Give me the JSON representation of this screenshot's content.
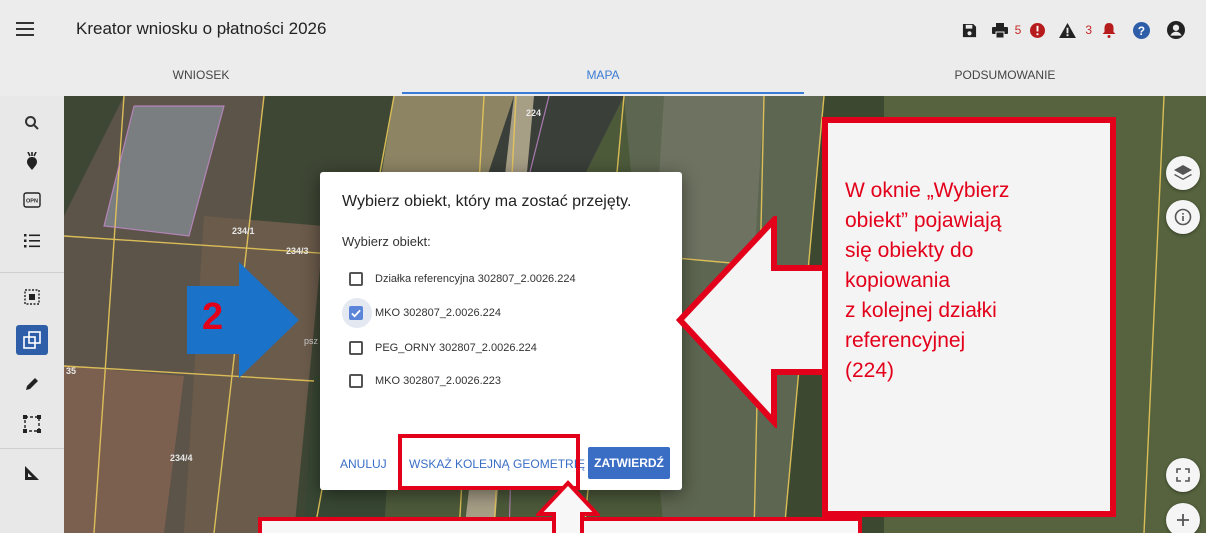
{
  "app": {
    "title": "Kreator wniosku o płatności 2026",
    "warning_count": "5",
    "alert_count": "3",
    "icons": [
      "menu-icon",
      "save-icon",
      "print-icon",
      "error-icon",
      "warning-icon",
      "bell-icon",
      "help-icon",
      "account-icon"
    ]
  },
  "tabs": [
    {
      "label": "WNIOSEK",
      "active": false
    },
    {
      "label": "MAPA",
      "active": true
    },
    {
      "label": "PODSUMOWANIE",
      "active": false
    }
  ],
  "sidebar": {
    "tools": [
      "search-icon",
      "beet-icon",
      "opn-icon",
      "list-icon",
      "select-area-icon",
      "copy-geometry-icon",
      "pencil-icon",
      "bounding-box-icon",
      "measure-icon"
    ],
    "opn_label": "OPN",
    "active_tool": "copy-geometry-icon"
  },
  "map": {
    "labels": {
      "parcel_2241": "234/1",
      "parcel_2243": "234/3",
      "parcel_2244": "234/4",
      "parcel_35": "35",
      "parcel_224": "224",
      "psz": "psz"
    },
    "controls": [
      "layers-icon",
      "info-icon",
      "fullscreen-icon",
      "zoom-in-icon"
    ]
  },
  "dialog": {
    "title": "Wybierz obiekt, który ma zostać przejęty.",
    "subtitle": "Wybierz obiekt:",
    "options": [
      {
        "label": "Działka referencyjna 302807_2.0026.224",
        "checked": false
      },
      {
        "label": "MKO 302807_2.0026.224",
        "checked": true
      },
      {
        "label": "PEG_ORNY 302807_2.0026.224",
        "checked": false
      },
      {
        "label": "MKO 302807_2.0026.223",
        "checked": false
      }
    ],
    "cancel_label": "ANULUJ",
    "next_geometry_label": "WSKAŻ KOLEJNĄ GEOMETRIĘ",
    "confirm_label": "ZATWIERDŹ"
  },
  "annotation": {
    "step_number": "2",
    "callout_lines": [
      "W oknie „Wybierz",
      "obiekt” pojawiają",
      "się obiekty do",
      "kopiowania",
      "z kolejnej działki",
      "referencyjnej",
      "(224)"
    ],
    "highlight_color": "#e3001b",
    "arrow_color": "#1a73c8"
  }
}
